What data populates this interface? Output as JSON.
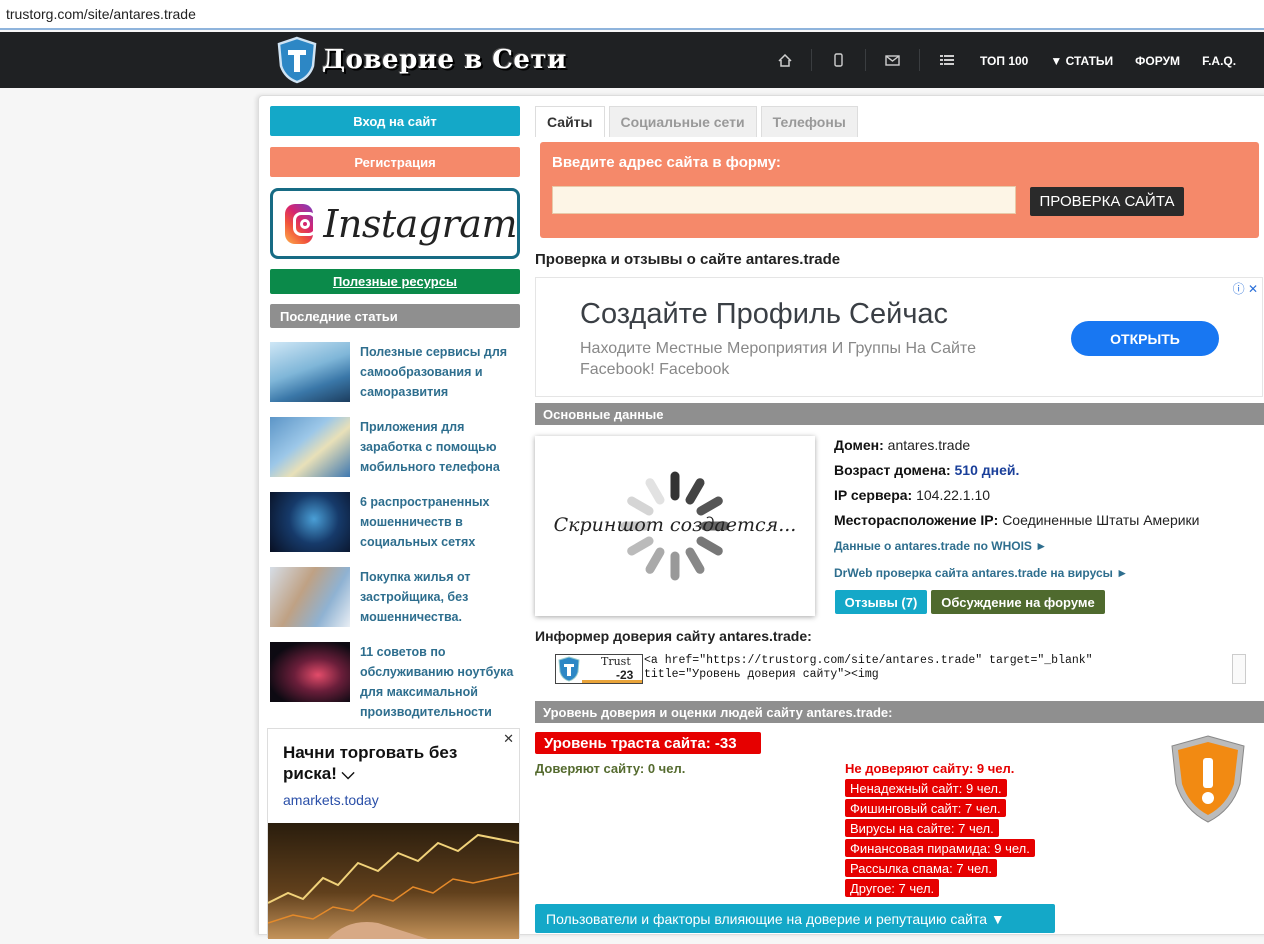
{
  "browser": {
    "url": "trustorg.com/site/antares.trade"
  },
  "header": {
    "logo_text": "Доверие в Сети",
    "nav": [
      "ТОП 100",
      "▼ СТАТЬИ",
      "ФОРУМ",
      "F.A.Q."
    ]
  },
  "sidebar": {
    "login": "Вход на сайт",
    "register": "Регистрация",
    "instagram": "Instagram",
    "resources": "Полезные ресурсы",
    "recent_title": "Последние статьи",
    "articles": [
      {
        "title": "Полезные сервисы для самообразования и саморазвития"
      },
      {
        "title": "Приложения для заработка с помощью мобильного телефона"
      },
      {
        "title": "6 распространенных мошенничеств в социальных сетях"
      },
      {
        "title": "Покупка жилья от застройщика, без мошенничества."
      },
      {
        "title": "11 советов по обслуживанию ноутбука для максимальной производительности"
      }
    ],
    "ad": {
      "title": "Начни торговать без риска!",
      "chevron": "⌵",
      "url": "amarkets.today",
      "close": "✕"
    }
  },
  "tabs": [
    "Сайты",
    "Социальные сети",
    "Телефоны"
  ],
  "form": {
    "label": "Введите адрес сайта в форму:",
    "button": "ПРОВЕРКА САЙТА",
    "value": ""
  },
  "check_title": "Проверка и отзывы о сайте antares.trade",
  "ad_banner": {
    "headline": "Создайте Профиль Сейчас",
    "sub": "Находите Местные Мероприятия И Группы На Сайте Facebook! Facebook",
    "button": "ОТКРЫТЬ",
    "info": "ⓘ ✕"
  },
  "main_data": {
    "header": "Основные данные",
    "screenshot_text": "Скриншот создается...",
    "domain_label": "Домен:",
    "domain": "antares.trade",
    "age_label": "Возраст домена:",
    "age": "510 дней.",
    "ip_label": "IP сервера:",
    "ip": "104.22.1.10",
    "loc_label": "Месторасположение IP:",
    "loc": "Соединенные Штаты Америки",
    "whois_link": "Данные о antares.trade по WHOIS ►",
    "drweb_link": "DrWeb проверка сайта antares.trade на вирусы ►",
    "reviews_btn": "Отзывы (7)",
    "forum_btn": "Обсуждение на форуме"
  },
  "informer": {
    "title": "Информер доверия сайту antares.trade:",
    "badge_label": "Trust",
    "badge_value": "-23",
    "code": "<a href=\"https://trustorg.com/site/antares.trade\" target=\"_blank\"\ntitle=\"Уровень доверия сайту\"><img"
  },
  "trust": {
    "header": "Уровень доверия и оценки людей сайту antares.trade:",
    "level": "Уровень траста сайта: -33",
    "trust_yes": "Доверяют сайту: 0 чел.",
    "trust_no": "Не доверяют сайту: 9 чел.",
    "reasons": [
      "Ненадежный сайт: 9 чел.",
      "Фишинговый сайт: 7 чел.",
      "Вирусы на сайте: 7 чел.",
      "Финансовая пирамида: 9 чел.",
      "Рассылка спама: 7 чел.",
      "Другое: 7 чел."
    ],
    "users_btn": "Пользователи и факторы влияющие на доверие и репутацию сайта ▼"
  },
  "colors": {
    "accent": "#14a8c8",
    "register": "#f5896a",
    "danger": "#e60000",
    "resources": "#0b8a4a"
  }
}
